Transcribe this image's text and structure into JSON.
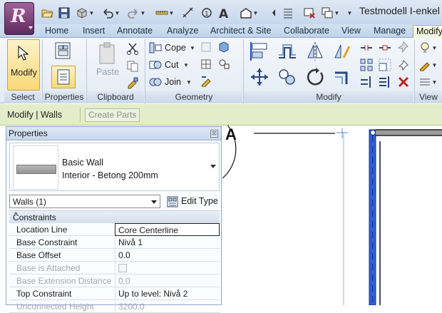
{
  "app": {
    "window_title": "Testmodell I-enkel",
    "app_button_letter": "R"
  },
  "tabs": [
    {
      "label": "Home"
    },
    {
      "label": "Insert"
    },
    {
      "label": "Annotate"
    },
    {
      "label": "Analyze"
    },
    {
      "label": "Architect & Site"
    },
    {
      "label": "Collaborate"
    },
    {
      "label": "View"
    },
    {
      "label": "Manage"
    },
    {
      "label": "Modify"
    }
  ],
  "ribbon": {
    "select": {
      "modify_label": "Modify",
      "panel_label": "Select"
    },
    "properties": {
      "panel_label": "Properties"
    },
    "clipboard": {
      "paste_label": "Paste",
      "panel_label": "Clipboard"
    },
    "geometry": {
      "cope_label": "Cope",
      "cut_label": "Cut",
      "join_label": "Join",
      "panel_label": "Geometry"
    },
    "modify": {
      "panel_label": "Modify"
    },
    "view": {
      "panel_label": "View"
    }
  },
  "options_bar": {
    "context_label": "Modify | Walls",
    "create_parts_label": "Create Parts"
  },
  "properties_palette": {
    "title": "Properties",
    "close_glyph": "☒",
    "type_family": "Basic Wall",
    "type_name": "Interior - Betong 200mm",
    "filter_value": "Walls (1)",
    "edit_type_label": "Edit Type",
    "group_label": "Constraints",
    "group_collapse_glyph": "⌃",
    "rows": [
      {
        "key": "Location Line",
        "value": "Core Centerline"
      },
      {
        "key": "Base Constraint",
        "value": "Nivå 1"
      },
      {
        "key": "Base Offset",
        "value": "0.0"
      },
      {
        "key": "Base is Attached",
        "value": ""
      },
      {
        "key": "Base Extension Distance",
        "value": "0.0"
      },
      {
        "key": "Top Constraint",
        "value": "Up to level: Nivå 2"
      },
      {
        "key": "Unconnected Height",
        "value": "3200.0"
      }
    ]
  },
  "canvas": {
    "grid_bubble_label": "A"
  },
  "colors": {
    "wall_selected": "#2f5fd6",
    "options_bar": "#e4edc9",
    "app_button": "#7a3a77"
  }
}
